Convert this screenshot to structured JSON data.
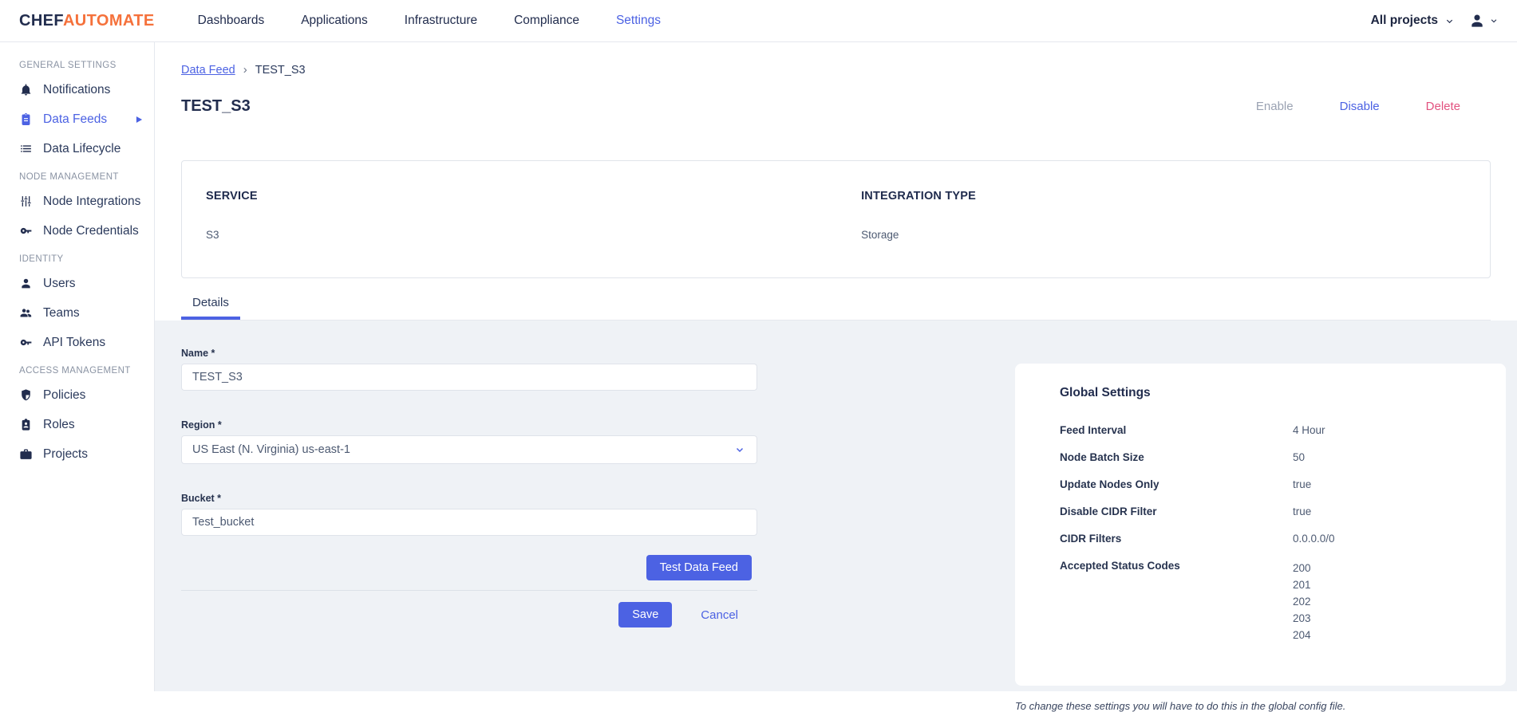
{
  "navbar": {
    "logo_chef": "CHEF",
    "logo_automate": "AUTOMATE",
    "items": [
      {
        "label": "Dashboards"
      },
      {
        "label": "Applications"
      },
      {
        "label": "Infrastructure"
      },
      {
        "label": "Compliance"
      },
      {
        "label": "Settings"
      }
    ],
    "projects_filter_label": "All projects"
  },
  "sidebar": {
    "sections": [
      {
        "heading": "GENERAL SETTINGS",
        "items": [
          {
            "label": "Notifications",
            "icon": "bell-icon"
          },
          {
            "label": "Data Feeds",
            "icon": "clipboard-icon"
          },
          {
            "label": "Data Lifecycle",
            "icon": "list-icon"
          }
        ]
      },
      {
        "heading": "NODE MANAGEMENT",
        "items": [
          {
            "label": "Node Integrations",
            "icon": "sliders-icon"
          },
          {
            "label": "Node Credentials",
            "icon": "key-icon"
          }
        ]
      },
      {
        "heading": "IDENTITY",
        "items": [
          {
            "label": "Users",
            "icon": "user-icon"
          },
          {
            "label": "Teams",
            "icon": "users-icon"
          },
          {
            "label": "API Tokens",
            "icon": "key-icon"
          }
        ]
      },
      {
        "heading": "ACCESS MANAGEMENT",
        "items": [
          {
            "label": "Policies",
            "icon": "shield-icon"
          },
          {
            "label": "Roles",
            "icon": "id-badge-icon"
          },
          {
            "label": "Projects",
            "icon": "briefcase-icon"
          }
        ]
      }
    ]
  },
  "main": {
    "breadcrumb": {
      "link": "Data Feed",
      "separator": "›",
      "current": "TEST_S3"
    },
    "title": "TEST_S3",
    "actions": {
      "enable": "Enable",
      "disable": "Disable",
      "delete": "Delete"
    },
    "summary": {
      "service_header": "SERVICE",
      "service_value": "S3",
      "integration_header": "INTEGRATION TYPE",
      "integration_value": "Storage"
    },
    "tabs": [
      {
        "label": "Details"
      }
    ],
    "form": {
      "name_label": "Name *",
      "name_value": "TEST_S3",
      "region_label": "Region *",
      "region_value": "US East (N. Virginia) us-east-1",
      "bucket_label": "Bucket *",
      "bucket_value": "Test_bucket",
      "test_button": "Test Data Feed",
      "save_button": "Save",
      "cancel_link": "Cancel"
    },
    "global_settings": {
      "title": "Global Settings",
      "rows": [
        {
          "label": "Feed Interval",
          "value": "4 Hour"
        },
        {
          "label": "Node Batch Size",
          "value": "50"
        },
        {
          "label": "Update Nodes Only",
          "value": "true"
        },
        {
          "label": "Disable CIDR Filter",
          "value": "true"
        },
        {
          "label": "CIDR Filters",
          "value": "0.0.0.0/0"
        },
        {
          "label": "Accepted Status Codes",
          "values": [
            "200",
            "201",
            "202",
            "203",
            "204"
          ]
        }
      ],
      "note": "To change these settings you will have to do this in the global config file."
    }
  },
  "colors": {
    "accent_blue": "#4c62e3",
    "brand_orange": "#f5713b",
    "delete_pink": "#e2527f",
    "navy_text": "#222d4e",
    "panel_bg": "#eff2f6"
  }
}
